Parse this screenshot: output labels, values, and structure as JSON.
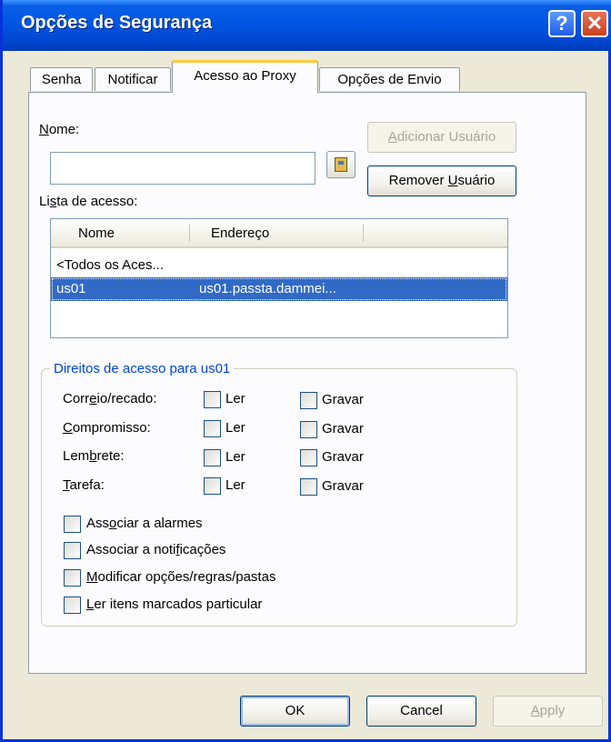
{
  "window": {
    "title": "Opções de Segurança"
  },
  "titlebar": {
    "help_icon": "?",
    "close_icon": "✕"
  },
  "tabs": [
    {
      "label": "Senha",
      "active": false
    },
    {
      "label": "Notificar",
      "active": false
    },
    {
      "label": "Acesso ao Proxy",
      "active": true
    },
    {
      "label": "Opções de Envio",
      "active": false
    }
  ],
  "name_section": {
    "label_prefix": "",
    "label_access": "N",
    "label_rest": "ome:",
    "value": "",
    "addrbook_icon": "address-book-icon"
  },
  "buttons": {
    "add_user": {
      "pre": "",
      "key": "A",
      "post": "dicionar Usuário",
      "enabled": false
    },
    "remove_user": {
      "pre": "Remover ",
      "key": "U",
      "post": "suário",
      "enabled": true
    },
    "ok": "OK",
    "cancel": "Cancel",
    "apply": {
      "pre": "",
      "key": "A",
      "post": "pply",
      "enabled": false
    }
  },
  "access_list": {
    "label_pre": "Li",
    "label_key": "s",
    "label_post": "ta de acesso:",
    "columns": [
      "Nome",
      "Endereço"
    ],
    "rows": [
      {
        "name": "<Todos os Aces...",
        "address": "",
        "selected": false
      },
      {
        "name": "us01",
        "address": "us01.passta.dammei...",
        "selected": true
      }
    ]
  },
  "rights": {
    "legend": "Direitos de acesso para us01",
    "read_label": "Ler",
    "write_label": "Gravar",
    "items": [
      {
        "pre": "Corr",
        "key": "e",
        "post": "io/recado:"
      },
      {
        "pre": "",
        "key": "C",
        "post": "ompromisso:"
      },
      {
        "pre": "Lem",
        "key": "b",
        "post": "rete:"
      },
      {
        "pre": "",
        "key": "T",
        "post": "arefa:"
      }
    ],
    "options": [
      {
        "pre": "Ass",
        "key": "o",
        "post": "ciar a alarmes"
      },
      {
        "pre": "Associar a noti",
        "key": "f",
        "post": "icações"
      },
      {
        "pre": "",
        "key": "M",
        "post": "odificar opções/regras/pastas"
      },
      {
        "pre": "",
        "key": "L",
        "post": "er itens marcados particular"
      }
    ]
  },
  "colors": {
    "titlebar": "#0055E3",
    "selection": "#316AC5",
    "legend": "#0046D5",
    "active_tab_accent": "#FFC83C"
  }
}
